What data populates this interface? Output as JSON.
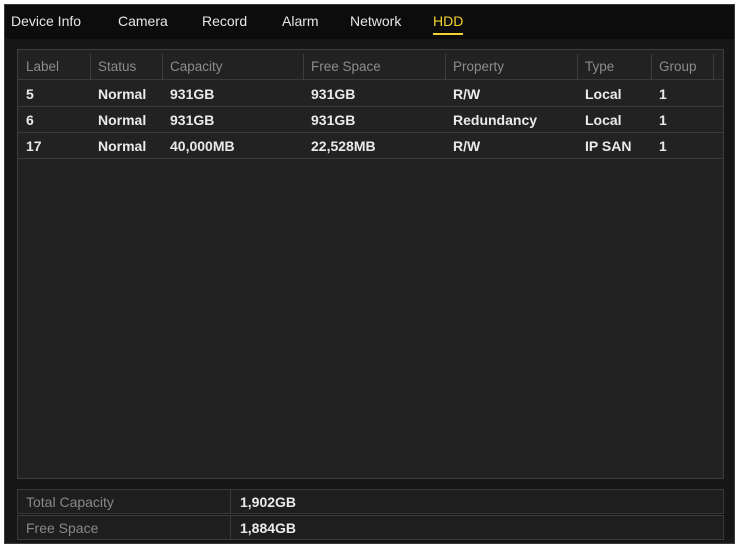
{
  "tabs": [
    {
      "label": "Device Info",
      "active": false
    },
    {
      "label": "Camera",
      "active": false
    },
    {
      "label": "Record",
      "active": false
    },
    {
      "label": "Alarm",
      "active": false
    },
    {
      "label": "Network",
      "active": false
    },
    {
      "label": "HDD",
      "active": true
    }
  ],
  "table": {
    "columns": [
      "Label",
      "Status",
      "Capacity",
      "Free Space",
      "Property",
      "Type",
      "Group"
    ],
    "rows": [
      [
        "5",
        "Normal",
        "931GB",
        "931GB",
        "R/W",
        "Local",
        "1"
      ],
      [
        "6",
        "Normal",
        "931GB",
        "931GB",
        "Redundancy",
        "Local",
        "1"
      ],
      [
        "17",
        "Normal",
        "40,000MB",
        "22,528MB",
        "R/W",
        "IP SAN",
        "1"
      ]
    ]
  },
  "summary": {
    "total_capacity_label": "Total Capacity",
    "total_capacity_value": "1,902GB",
    "free_space_label": "Free Space",
    "free_space_value": "1,884GB"
  },
  "colors": {
    "active_tab": "#f2d22e",
    "panel_bg": "#161616",
    "text": "#eaeaea",
    "header_text": "#8c8c8c"
  }
}
